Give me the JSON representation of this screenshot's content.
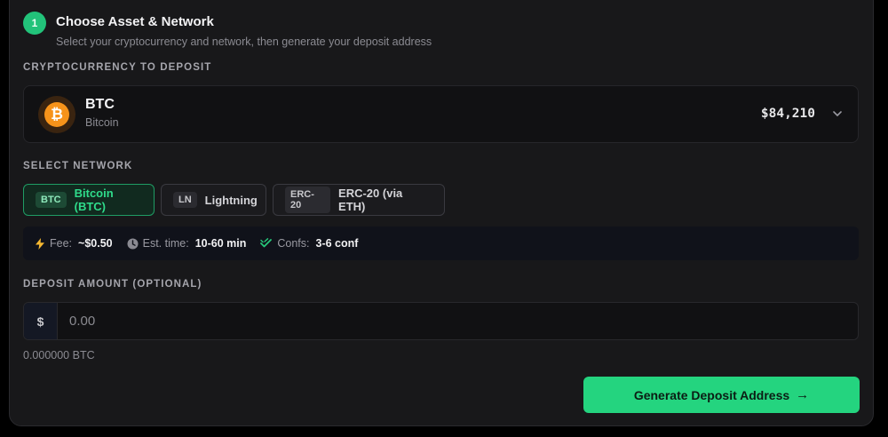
{
  "step": {
    "number": "1",
    "title": "Choose Asset & Network",
    "subtitle": "Select your cryptocurrency and network, then generate your deposit address"
  },
  "asset_section": {
    "label": "CRYPTOCURRENCY TO DEPOSIT",
    "selected": {
      "symbol": "BTC",
      "name": "Bitcoin",
      "price": "$84,210",
      "icon": "bitcoin-icon",
      "glyph": "₿"
    }
  },
  "network_section": {
    "label": "SELECT NETWORK",
    "networks": [
      {
        "tag": "BTC",
        "label": "Bitcoin (BTC)",
        "active": true
      },
      {
        "tag": "LN",
        "label": "Lightning",
        "active": false
      },
      {
        "tag": "ERC-20",
        "label": "ERC-20 (via ETH)",
        "active": false
      }
    ]
  },
  "network_info": {
    "fee_label": "Fee:",
    "fee_value": "~$0.50",
    "time_label": "Est. time:",
    "time_value": "10-60 min",
    "confs_label": "Confs:",
    "confs_value": "3-6 conf"
  },
  "amount_section": {
    "label": "DEPOSIT AMOUNT (OPTIONAL)",
    "currency_prefix": "$",
    "placeholder": "0.00",
    "btc_equivalent": "0.000000 BTC"
  },
  "actions": {
    "generate_label": "Generate Deposit Address",
    "generate_arrow": "→"
  },
  "colors": {
    "accent": "#24d47f",
    "bitcoin": "#f7931a",
    "background": "#18181a"
  }
}
